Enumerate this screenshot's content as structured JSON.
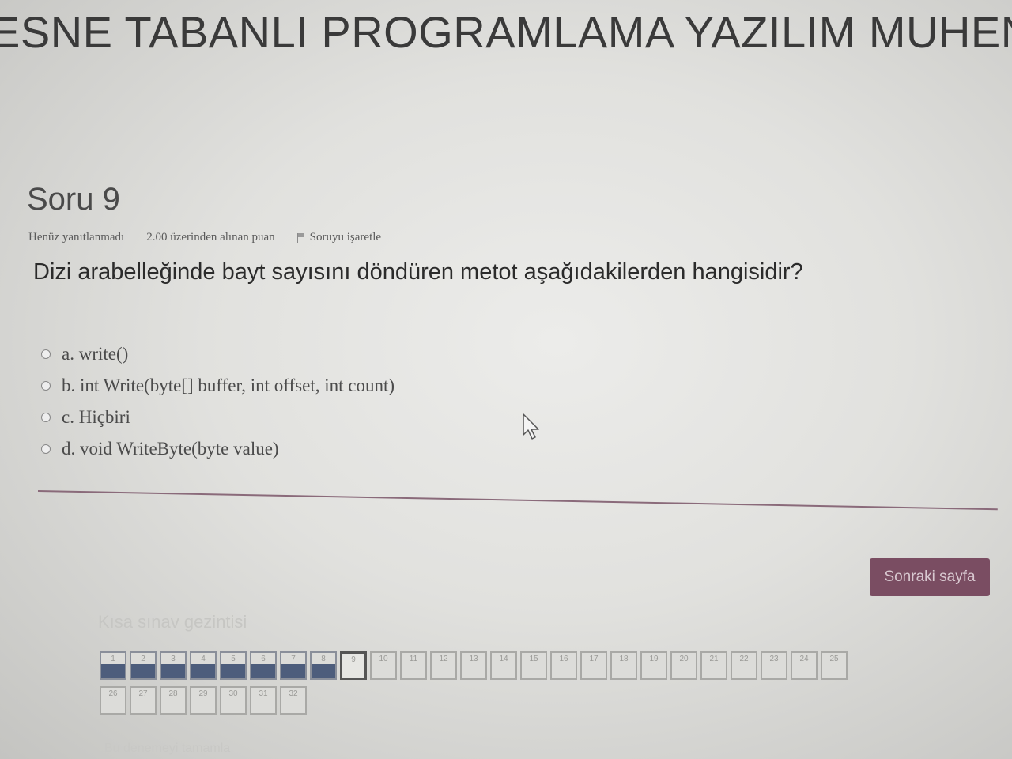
{
  "header": {
    "course_title": "ESNE TABANLI PROGRAMLAMA YAZILIM MUHENDİ"
  },
  "question": {
    "number_label": "Soru 9",
    "status": "Henüz yanıtlanmadı",
    "points": "2.00 üzerinden alınan puan",
    "flag_label": "Soruyu işaretle",
    "text": "Dizi arabelleğinde bayt sayısını döndüren metot aşağıdakilerden hangisidir?",
    "options": [
      "a. write()",
      "b. int Write(byte[] buffer, int offset, int count)",
      "c. Hiçbiri",
      "d. void WriteByte(byte value)"
    ]
  },
  "actions": {
    "next_label": "Sonraki sayfa"
  },
  "navigation": {
    "title": "Kısa sınav gezintisi",
    "row1": [
      "1",
      "2",
      "3",
      "4",
      "5",
      "6",
      "7",
      "8",
      "9",
      "10",
      "11",
      "12",
      "13",
      "14",
      "15",
      "16",
      "17",
      "18",
      "19",
      "20",
      "21",
      "22",
      "23",
      "24",
      "25"
    ],
    "row2": [
      "26",
      "27",
      "28",
      "29",
      "30",
      "31",
      "32"
    ],
    "answered_count": 8,
    "current": "9",
    "finish_label": "Bu denemeyi tamamla"
  },
  "colors": {
    "accent": "#7a4d62",
    "answered": "#4d5d7c"
  }
}
